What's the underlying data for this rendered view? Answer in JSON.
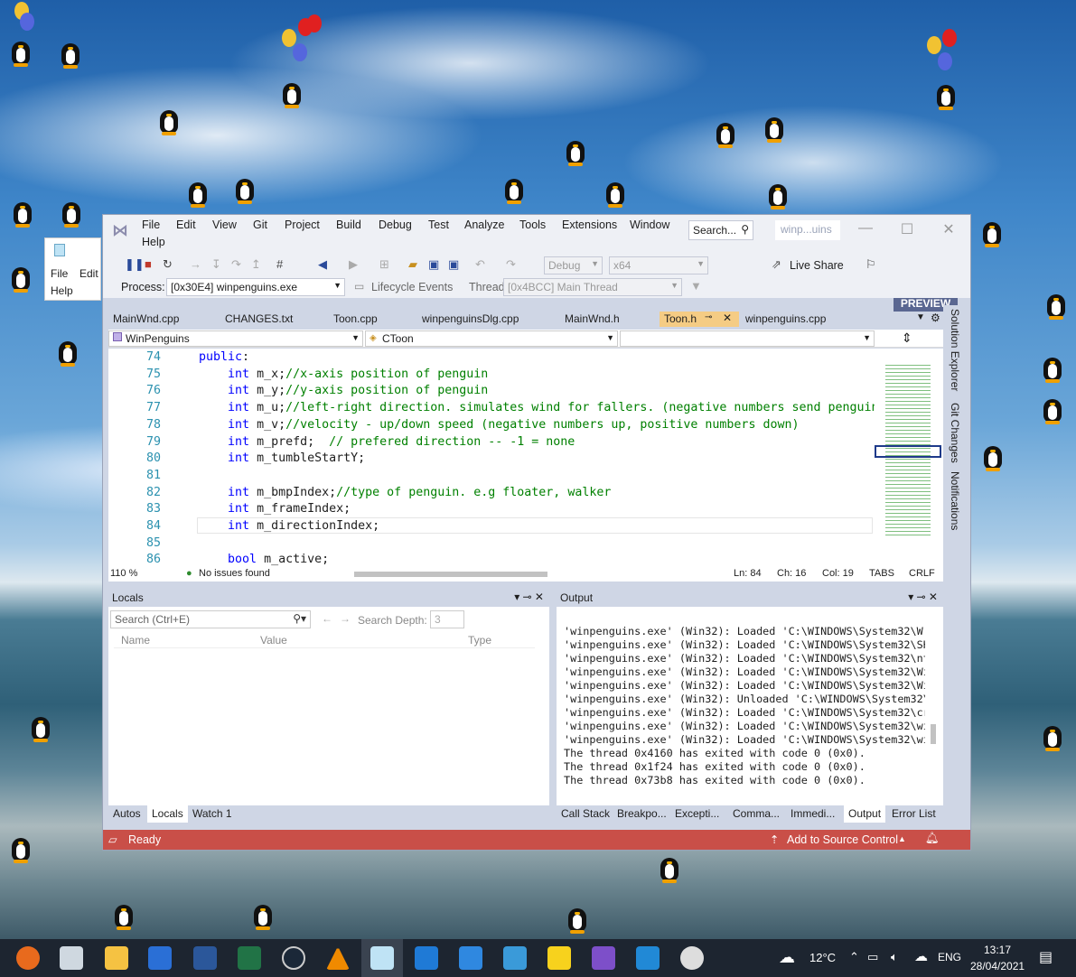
{
  "notepad": {
    "menu_file": "File",
    "menu_edit": "Edit",
    "menu_help": "Help"
  },
  "vs": {
    "menu": [
      "File",
      "Edit",
      "View",
      "Git",
      "Project",
      "Build",
      "Debug",
      "Test",
      "Analyze",
      "Tools",
      "Extensions",
      "Window",
      "Help"
    ],
    "search_label": "Search...",
    "window_name": "winp...uins",
    "live_share": "Live Share",
    "preview": "PREVIEW",
    "config": "Debug",
    "platform": "x64",
    "process_label": "Process:",
    "process_value": "[0x30E4] winpenguins.exe",
    "lifecycle": "Lifecycle Events",
    "thread_label": "Thread:",
    "thread_value": "[0x4BCC] Main Thread",
    "tabs": [
      "MainWnd.cpp",
      "CHANGES.txt",
      "Toon.cpp",
      "winpenguinsDlg.cpp",
      "MainWnd.h",
      "Toon.h",
      "winpenguins.cpp"
    ],
    "nav_project": "WinPenguins",
    "nav_class": "CToon",
    "side_tabs": [
      "Solution Explorer",
      "Git Changes",
      "Notifications"
    ],
    "code_lines": [
      {
        "n": "74",
        "t": "public:"
      },
      {
        "n": "75",
        "t": "    int m_x;//x-axis position of penguin"
      },
      {
        "n": "76",
        "t": "    int m_y;//y-axis position of penguin"
      },
      {
        "n": "77",
        "t": "    int m_u;//left-right direction. simulates wind for fallers. (negative numbers send penguins"
      },
      {
        "n": "78",
        "t": "    int m_v;//velocity - up/down speed (negative numbers up, positive numbers down)"
      },
      {
        "n": "79",
        "t": "    int m_prefd;  // prefered direction -- -1 = none"
      },
      {
        "n": "80",
        "t": "    int m_tumbleStartY;"
      },
      {
        "n": "81",
        "t": ""
      },
      {
        "n": "82",
        "t": "    int m_bmpIndex;//type of penguin. e.g floater, walker"
      },
      {
        "n": "83",
        "t": "    int m_frameIndex;"
      },
      {
        "n": "84",
        "t": "    int m_directionIndex;"
      },
      {
        "n": "85",
        "t": ""
      },
      {
        "n": "86",
        "t": "    bool m_active;"
      }
    ],
    "status": {
      "zoom": "110 %",
      "issues": "No issues found",
      "ln": "Ln: 84",
      "ch": "Ch: 16",
      "col": "Col: 19",
      "tabs": "TABS",
      "crlf": "CRLF"
    },
    "locals": {
      "title": "Locals",
      "search_placeholder": "Search (Ctrl+E)",
      "search_depth_label": "Search Depth:",
      "search_depth": "3",
      "col_name": "Name",
      "col_value": "Value",
      "col_type": "Type"
    },
    "bottom_left_tabs": [
      "Autos",
      "Locals",
      "Watch 1"
    ],
    "output": {
      "title": "Output",
      "lines": [
        "'winpenguins.exe' (Win32): Loaded 'C:\\WINDOWS\\System32\\W",
        "'winpenguins.exe' (Win32): Loaded 'C:\\WINDOWS\\System32\\SH",
        "'winpenguins.exe' (Win32): Loaded 'C:\\WINDOWS\\System32\\nt",
        "'winpenguins.exe' (Win32): Loaded 'C:\\WINDOWS\\System32\\Wi",
        "'winpenguins.exe' (Win32): Loaded 'C:\\WINDOWS\\System32\\Wi",
        "'winpenguins.exe' (Win32): Unloaded 'C:\\WINDOWS\\System32\\",
        "'winpenguins.exe' (Win32): Loaded 'C:\\WINDOWS\\System32\\cr",
        "'winpenguins.exe' (Win32): Loaded 'C:\\WINDOWS\\System32\\wi",
        "'winpenguins.exe' (Win32): Loaded 'C:\\WINDOWS\\System32\\wi",
        "The thread 0x4160 has exited with code 0 (0x0).",
        "The thread 0x1f24 has exited with code 0 (0x0).",
        "The thread 0x73b8 has exited with code 0 (0x0)."
      ]
    },
    "bottom_right_tabs": [
      "Call Stack",
      "Breakpo...",
      "Excepti...",
      "Comma...",
      "Immedi...",
      "Output",
      "Error List"
    ],
    "statusbar": {
      "ready": "Ready",
      "source_control": "Add to Source Control"
    }
  },
  "taskbar": {
    "weather": "12°C",
    "lang": "ENG",
    "time": "13:17",
    "date": "28/04/2021"
  },
  "colors": {
    "vs_accent": "#5a6791",
    "status_red": "#c94f48",
    "active_tab": "#f5cc84",
    "taskbar": "#1d2530"
  }
}
